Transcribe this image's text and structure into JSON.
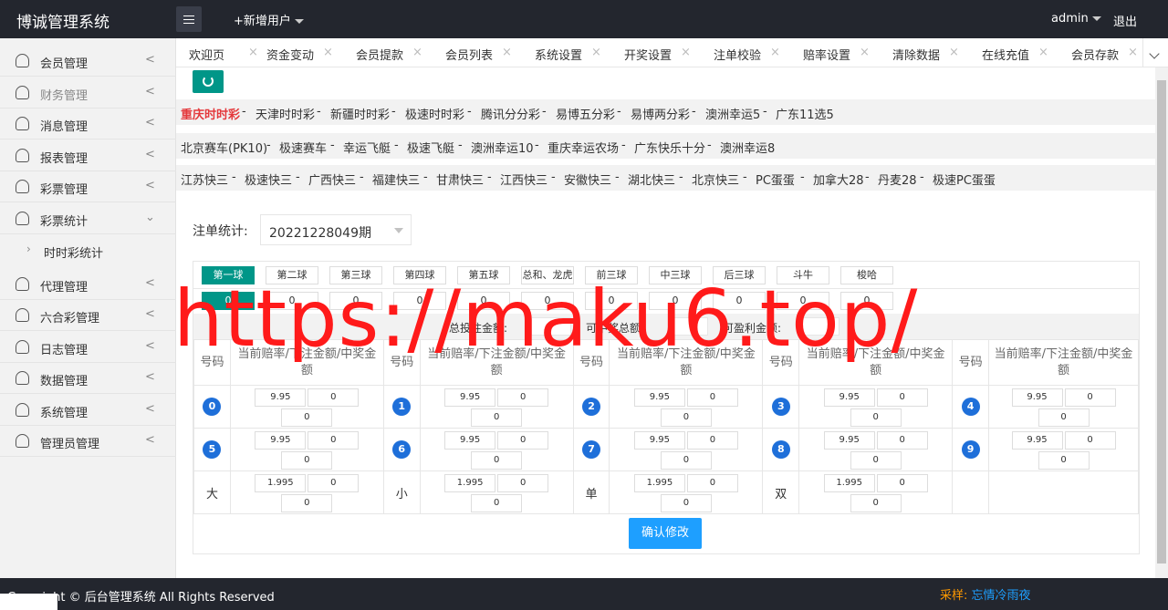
{
  "header": {
    "app_title": "博诚管理系统",
    "add_user": "+新增用户",
    "user": "admin",
    "logout": "退出"
  },
  "sidebar": {
    "items": [
      {
        "label": "会员管理"
      },
      {
        "label": "财务管理"
      },
      {
        "label": "消息管理"
      },
      {
        "label": "报表管理"
      },
      {
        "label": "彩票管理"
      },
      {
        "label": "彩票统计"
      },
      {
        "label": "代理管理"
      },
      {
        "label": "六合彩管理"
      },
      {
        "label": "日志管理"
      },
      {
        "label": "数据管理"
      },
      {
        "label": "系统管理"
      },
      {
        "label": "管理员管理"
      }
    ],
    "sub_item": "时时彩统计"
  },
  "tabs": [
    "欢迎页",
    "资金变动",
    "会员提款",
    "会员列表",
    "系统设置",
    "开奖设置",
    "注单校验",
    "赔率设置",
    "清除数据",
    "在线充值",
    "会员存款"
  ],
  "lotteries": {
    "row1": [
      "重庆时时彩",
      "天津时时彩",
      "新疆时时彩",
      "极速时时彩",
      "腾讯分分彩",
      "易博五分彩",
      "易博两分彩",
      "澳洲幸运5",
      "广东11选5"
    ],
    "row2": [
      "北京赛车(PK10)",
      "极速赛车",
      "幸运飞艇",
      "极速飞艇",
      "澳洲幸运10",
      "重庆幸运农场",
      "广东快乐十分",
      "澳洲幸运8"
    ],
    "row3": [
      "江苏快三",
      "极速快三",
      "广西快三",
      "福建快三",
      "甘肃快三",
      "江西快三",
      "安徽快三",
      "湖北快三",
      "北京快三",
      "PC蛋蛋",
      "加拿大28",
      "丹麦28",
      "极速PC蛋蛋"
    ],
    "separator": "-"
  },
  "stats": {
    "label": "注单统计:",
    "period": "20221228049期"
  },
  "ball_tabs": [
    "第一球",
    "第二球",
    "第三球",
    "第四球",
    "第五球",
    "总和、龙虎",
    "前三球",
    "中三球",
    "后三球",
    "斗牛",
    "梭哈"
  ],
  "ball_sums": [
    "0",
    "0",
    "0",
    "0",
    "0",
    "0",
    "0",
    "0",
    "0",
    "0",
    "0"
  ],
  "totals": {
    "total_bet": "总投注金额:",
    "total_win": "可中奖总额:",
    "profit": "可盈利金额:"
  },
  "table": {
    "col_no": "号码",
    "col_rate": "当前赔率/下注金额/中奖金额",
    "rows": [
      [
        {
          "no": "0",
          "rate": "9.95",
          "bet": "0",
          "win": "0"
        },
        {
          "no": "1",
          "rate": "9.95",
          "bet": "0",
          "win": "0"
        },
        {
          "no": "2",
          "rate": "9.95",
          "bet": "0",
          "win": "0"
        },
        {
          "no": "3",
          "rate": "9.95",
          "bet": "0",
          "win": "0"
        },
        {
          "no": "4",
          "rate": "9.95",
          "bet": "0",
          "win": "0"
        }
      ],
      [
        {
          "no": "5",
          "rate": "9.95",
          "bet": "0",
          "win": "0"
        },
        {
          "no": "6",
          "rate": "9.95",
          "bet": "0",
          "win": "0"
        },
        {
          "no": "7",
          "rate": "9.95",
          "bet": "0",
          "win": "0"
        },
        {
          "no": "8",
          "rate": "9.95",
          "bet": "0",
          "win": "0"
        },
        {
          "no": "9",
          "rate": "9.95",
          "bet": "0",
          "win": "0"
        }
      ],
      [
        {
          "no": "大",
          "rate": "1.995",
          "bet": "0",
          "win": "0"
        },
        {
          "no": "小",
          "rate": "1.995",
          "bet": "0",
          "win": "0"
        },
        {
          "no": "单",
          "rate": "1.995",
          "bet": "0",
          "win": "0"
        },
        {
          "no": "双",
          "rate": "1.995",
          "bet": "0",
          "win": "0"
        }
      ]
    ]
  },
  "confirm": "确认修改",
  "footer": {
    "copyright": "Copyright © 后台管理系统 All Rights Reserved",
    "source_label": "采样:",
    "source_name": "忘情冷雨夜"
  },
  "watermark": "https://maku6.top/",
  "colors": {
    "header_bg": "#23262e",
    "accent": "#009688",
    "blue": "#1e9fff",
    "active_lottery": "#e4393c",
    "watermark": "#ff1a1a"
  }
}
